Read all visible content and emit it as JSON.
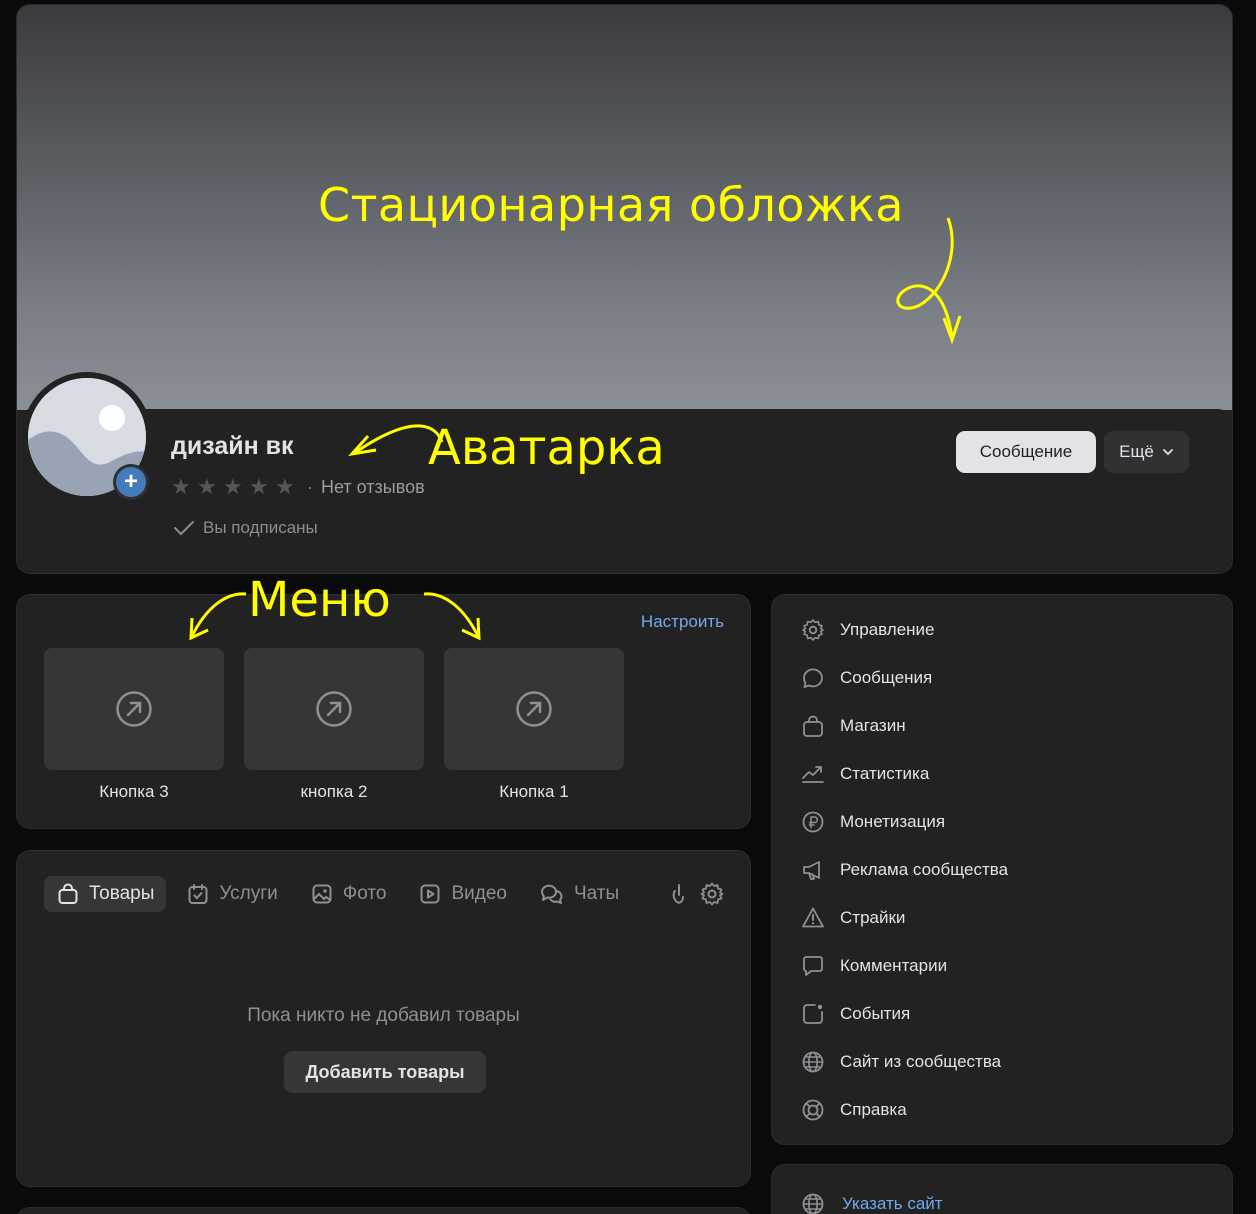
{
  "cover": {
    "annotation": "Стационарная обложка"
  },
  "profile": {
    "name": "дизайн вк",
    "avatar_annotation": "Аватарка",
    "stars": 5,
    "reviews_text": "Нет отзывов",
    "subscribed_text": "Вы подписаны",
    "message_button": "Сообщение",
    "more_button": "Ещё"
  },
  "menu": {
    "annotation": "Меню",
    "configure_link": "Настроить",
    "tiles": [
      {
        "label": "Кнопка 3"
      },
      {
        "label": "кнопка 2"
      },
      {
        "label": "Кнопка 1"
      }
    ]
  },
  "tabs": {
    "items": [
      {
        "label": "Товары",
        "icon": "bag-icon",
        "active": true
      },
      {
        "label": "Услуги",
        "icon": "calendar-check-icon",
        "active": false
      },
      {
        "label": "Фото",
        "icon": "image-icon",
        "active": false
      },
      {
        "label": "Видео",
        "icon": "play-icon",
        "active": false
      },
      {
        "label": "Чаты",
        "icon": "chats-icon",
        "active": false
      }
    ],
    "empty_text": "Пока никто не добавил товары",
    "add_button": "Добавить товары"
  },
  "sidebar": {
    "items": [
      {
        "label": "Управление",
        "icon": "gear-icon"
      },
      {
        "label": "Сообщения",
        "icon": "message-icon"
      },
      {
        "label": "Магазин",
        "icon": "bag-icon"
      },
      {
        "label": "Статистика",
        "icon": "chart-icon"
      },
      {
        "label": "Монетизация",
        "icon": "ruble-icon"
      },
      {
        "label": "Реклама сообщества",
        "icon": "megaphone-icon"
      },
      {
        "label": "Страйки",
        "icon": "warning-icon"
      },
      {
        "label": "Комментарии",
        "icon": "comment-icon"
      },
      {
        "label": "События",
        "icon": "event-icon"
      },
      {
        "label": "Сайт из сообщества",
        "icon": "globe-icon"
      },
      {
        "label": "Справка",
        "icon": "lifebuoy-icon"
      }
    ],
    "specify_site": "Указать сайт"
  },
  "colors": {
    "accent": "#71aaeb",
    "annotation": "#ffff00",
    "avatar_badge": "#447bba"
  }
}
